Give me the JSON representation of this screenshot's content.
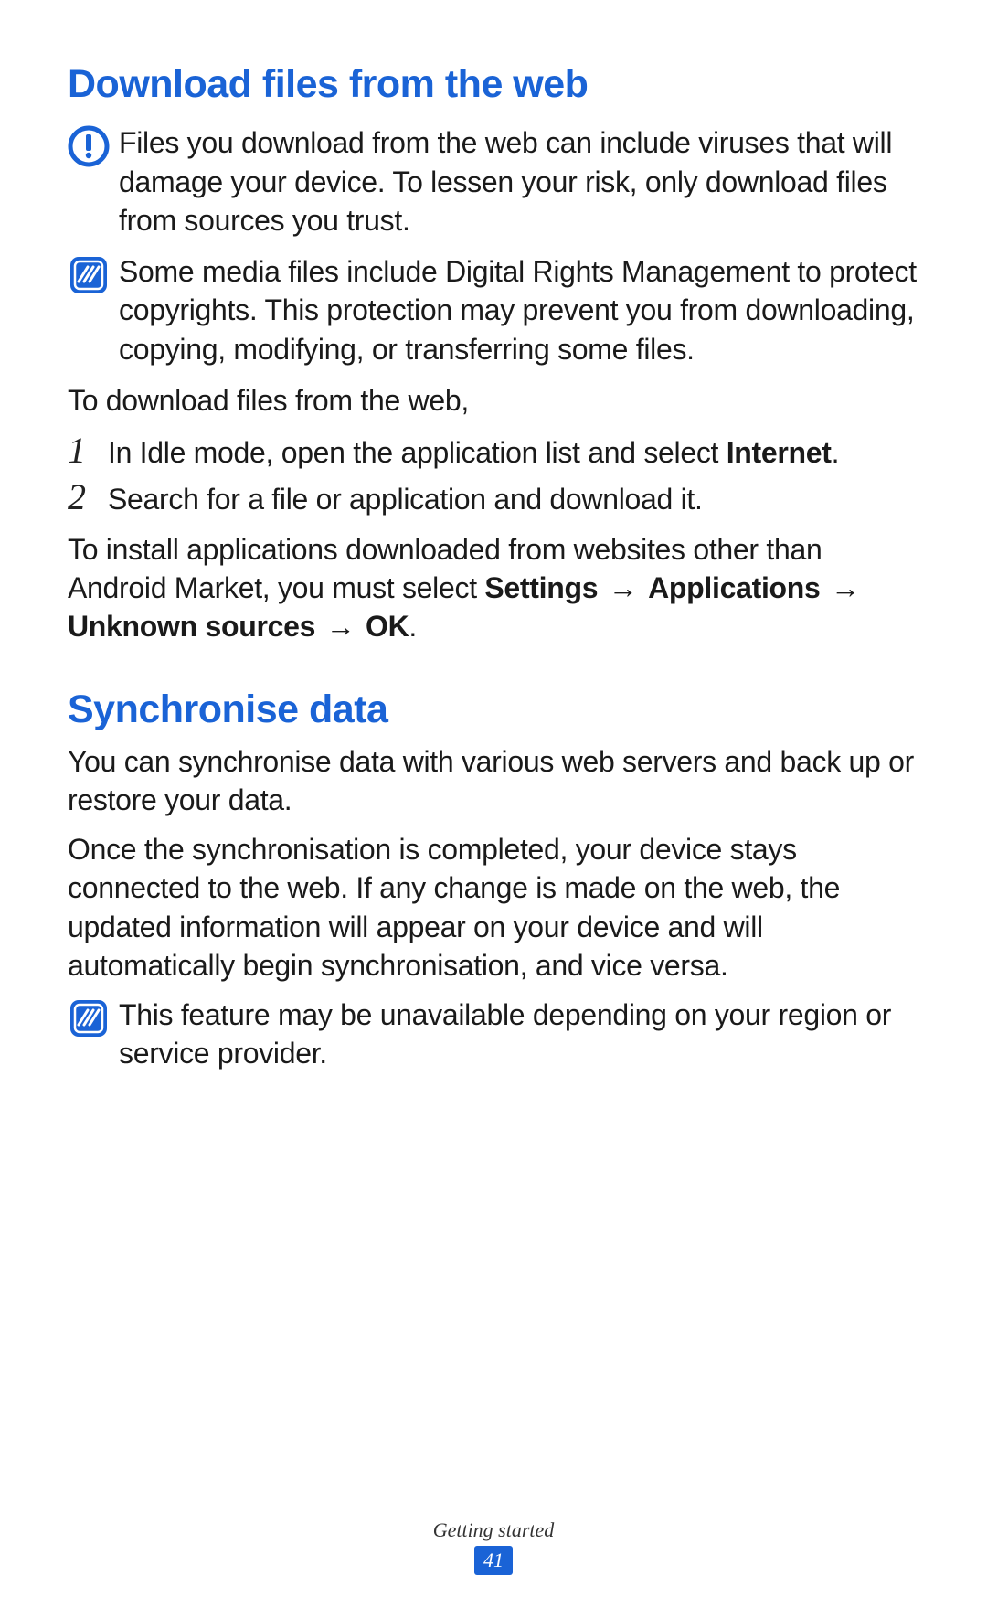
{
  "section1": {
    "heading": "Download files from the web",
    "warning": "Files you download from the web can include viruses that will damage your device. To lessen your risk, only download files from sources you trust.",
    "note_drm": "Some media files include Digital Rights Management to protect copyrights. This protection may prevent you from downloading, copying, modifying, or transferring some files.",
    "intro": "To download files from the web,",
    "step1_pre": "In Idle mode, open the application list and select ",
    "step1_bold": "Internet",
    "step1_post": ".",
    "step2": "Search for a file or application and download it.",
    "install_pre": "To install applications downloaded from websites other than Android Market, you must select ",
    "install_b1": "Settings",
    "install_b2": "Applications",
    "install_b3": "Unknown sources",
    "install_b4": "OK",
    "install_post": ".",
    "arrow": "→"
  },
  "section2": {
    "heading": "Synchronise data",
    "p1": "You can synchronise data with various web servers and back up or restore your data.",
    "p2": "Once the synchronisation is completed, your device stays connected to the web. If any change is made on the web, the updated information will appear on your device and will automatically begin synchronisation, and vice versa.",
    "note_region": "This feature may be unavailable depending on your region or service provider."
  },
  "steps": {
    "n1": "1",
    "n2": "2"
  },
  "footer": {
    "section": "Getting started",
    "page": "41"
  },
  "colors": {
    "accent": "#1a63d6"
  }
}
